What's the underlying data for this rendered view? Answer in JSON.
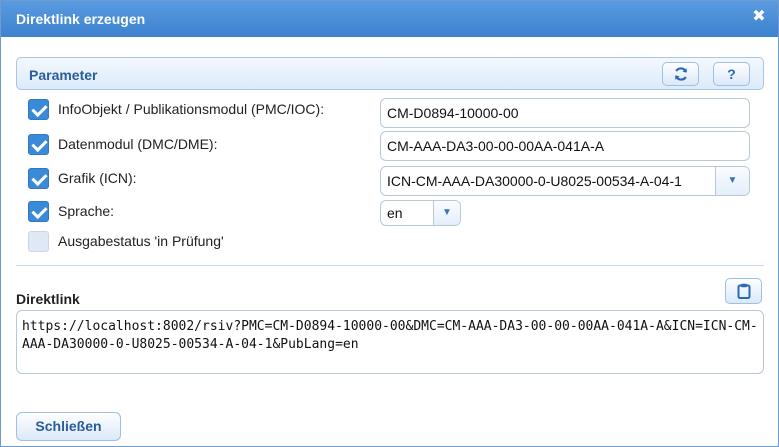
{
  "dialog": {
    "title": "Direktlink erzeugen",
    "close_icon": "close-icon"
  },
  "parameter": {
    "header": "Parameter",
    "refresh_icon": "refresh-icon",
    "help_label": "?",
    "options": [
      {
        "label": "InfoObjekt / Publikationsmodul (PMC/IOC):",
        "checked": true,
        "value": "CM-D0894-10000-00"
      },
      {
        "label": "Datenmodul (DMC/DME):",
        "checked": true,
        "value": "CM-AAA-DA3-00-00-00AA-041A-A"
      },
      {
        "label": "Grafik (ICN):",
        "checked": true,
        "value": "ICN-CM-AAA-DA30000-0-U8025-00534-A-04-1"
      },
      {
        "label": "Sprache:",
        "checked": true,
        "value": "en"
      },
      {
        "label": "Ausgabestatus 'in Prüfung'",
        "checked": false
      }
    ]
  },
  "direktlink": {
    "label": "Direktlink",
    "clipboard_icon": "clipboard-icon",
    "url": "https://localhost:8002/rsiv?PMC=CM-D0894-10000-00&DMC=CM-AAA-DA3-00-00-00AA-041A-A&ICN=ICN-CM-AAA-DA30000-0-U8025-00534-A-04-1&PubLang=en"
  },
  "footer": {
    "close_label": "Schließen"
  },
  "colors": {
    "titlebar": "#3c82cf",
    "accent": "#2a5d9b",
    "checkbox": "#3a8ad8"
  }
}
